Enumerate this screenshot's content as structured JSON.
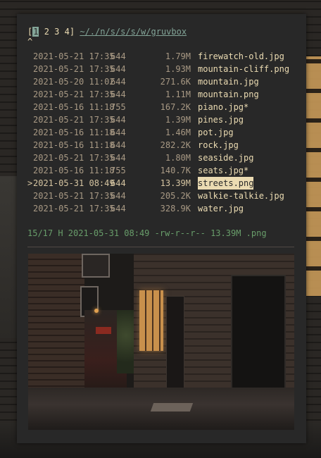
{
  "tabs": [
    "1",
    "2",
    "3",
    "4"
  ],
  "active_tab_index": 0,
  "tabs_close": "]",
  "tabs_open": "[",
  "path": "~/./n/s/s/s/w/gruvbox",
  "caret": "^",
  "files": [
    {
      "sel": " ",
      "date": "2021-05-21 17:35",
      "perm": "644",
      "size": "1.79M",
      "name": "firewatch-old.jpg"
    },
    {
      "sel": " ",
      "date": "2021-05-21 17:35",
      "perm": "644",
      "size": "1.93M",
      "name": "mountain-cliff.png"
    },
    {
      "sel": " ",
      "date": "2021-05-20 11:02",
      "perm": "644",
      "size": "271.6K",
      "name": "mountain.jpg"
    },
    {
      "sel": " ",
      "date": "2021-05-21 17:35",
      "perm": "644",
      "size": "1.11M",
      "name": "mountain.png"
    },
    {
      "sel": " ",
      "date": "2021-05-16 11:18",
      "perm": "755",
      "size": "167.2K",
      "name": "piano.jpg*"
    },
    {
      "sel": " ",
      "date": "2021-05-21 17:35",
      "perm": "644",
      "size": "1.39M",
      "name": "pines.jpg"
    },
    {
      "sel": " ",
      "date": "2021-05-16 11:18",
      "perm": "644",
      "size": "1.46M",
      "name": "pot.jpg"
    },
    {
      "sel": " ",
      "date": "2021-05-16 11:18",
      "perm": "644",
      "size": "282.2K",
      "name": "rock.jpg"
    },
    {
      "sel": " ",
      "date": "2021-05-21 17:35",
      "perm": "644",
      "size": "1.80M",
      "name": "seaside.jpg"
    },
    {
      "sel": " ",
      "date": "2021-05-16 11:18",
      "perm": "755",
      "size": "140.7K",
      "name": "seats.jpg*"
    },
    {
      "sel": ">",
      "date": "2021-05-31 08:49",
      "perm": "644",
      "size": "13.39M",
      "name": "streets.png"
    },
    {
      "sel": " ",
      "date": "2021-05-21 17:35",
      "perm": "644",
      "size": "205.2K",
      "name": "walkie-talkie.jpg"
    },
    {
      "sel": " ",
      "date": "2021-05-21 17:35",
      "perm": "644",
      "size": "328.9K",
      "name": "water.jpg"
    }
  ],
  "selected_index": 10,
  "status": "15/17 H 2021-05-31 08:49 -rw-r--r-- 13.39M .png",
  "colors": {
    "background": "#282828",
    "foreground": "#ebdbb2",
    "muted": "#a89984",
    "path": "#83a598",
    "status": "#689d6a",
    "divider": "#504945"
  }
}
